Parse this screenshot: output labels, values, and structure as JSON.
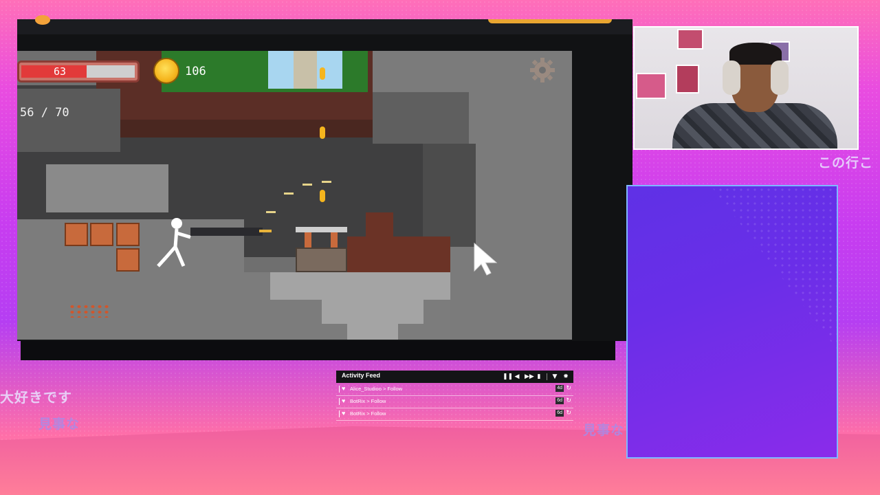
{
  "game": {
    "health": "63",
    "coins": "106",
    "ammo": "56 / 70"
  },
  "activity_feed": {
    "title": "Activity Feed",
    "controls": [
      "pause-icon",
      "volume-icon",
      "skip-icon",
      "trash-icon",
      "filter-icon",
      "gear-icon"
    ],
    "items": [
      {
        "text": "Alice_Studioo > Follow",
        "age": "4d"
      },
      {
        "text": "BotRix > Follow",
        "age": "6d"
      },
      {
        "text": "BotRix > Follow",
        "age": "6d"
      }
    ]
  },
  "overlay_text": {
    "jp1": "大好きです",
    "jp2": "見事な",
    "jp3": "見事な",
    "jp4": "この行こ"
  },
  "colors": {
    "background_accent": "#c83df0",
    "panel": "#6a2ee8",
    "health_fill": "#e23a3a",
    "coin": "#f5b51e"
  }
}
